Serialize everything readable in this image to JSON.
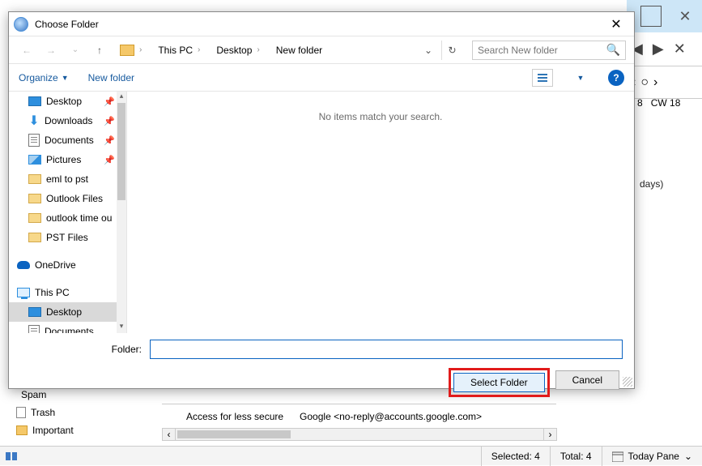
{
  "dialog": {
    "title": "Choose Folder",
    "close_glyph": "✕",
    "breadcrumb": {
      "root_glyph": "›",
      "pc": "This PC",
      "desk": "Desktop",
      "newf": "New folder"
    },
    "refresh_glyph": "↻",
    "search_placeholder": "Search New folder",
    "organize": "Organize",
    "new_folder": "New folder",
    "help_glyph": "?",
    "empty_msg": "No items match your search.",
    "tree": {
      "desktop": "Desktop",
      "downloads": "Downloads",
      "documents": "Documents",
      "pictures": "Pictures",
      "eml": "eml to pst",
      "outlookf": "Outlook Files",
      "outlooktb": "outlook time ou",
      "pst": "PST Files",
      "onedrive": "OneDrive",
      "thispc": "This PC",
      "desktop2": "Desktop",
      "documents2": "Documents"
    },
    "folder_label": "Folder:",
    "select_btn": "Select Folder",
    "cancel_btn": "Cancel"
  },
  "background": {
    "cw": "CW 18",
    "week8": "8",
    "days": "days)",
    "spam": "Spam",
    "trash": "Trash",
    "important": "Important",
    "mail_subject": "Access for less secure",
    "mail_from": "Google <no-reply@accounts.google.com>"
  },
  "status": {
    "selected": "Selected: 4",
    "total": "Total: 4",
    "today": "Today Pane"
  }
}
